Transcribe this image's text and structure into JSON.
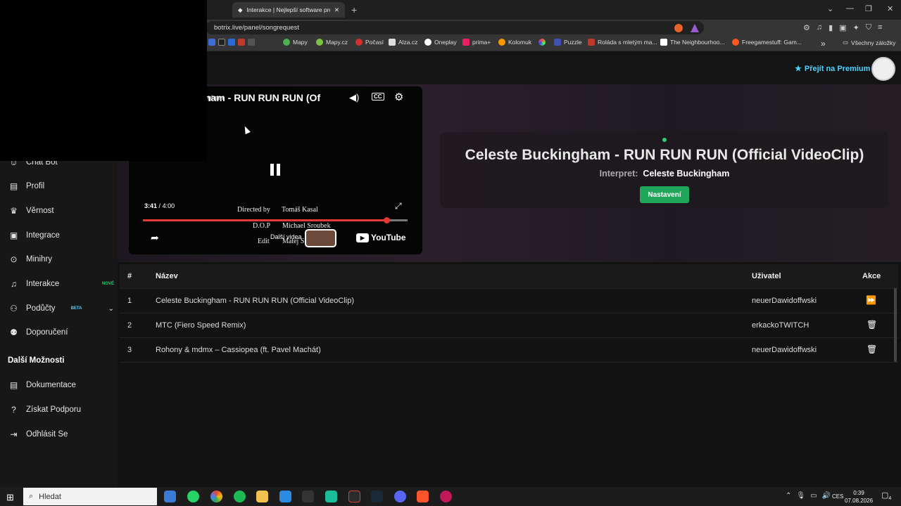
{
  "browser": {
    "tab_title": "Interakce | Nejlepší software pro",
    "url": "botrix.live/panel/songrequest"
  },
  "bookmarks": [
    "Mapy",
    "Mapy.cz",
    "Počasí",
    "Alza.cz",
    "Oneplay",
    "prima+",
    "Kolomuk",
    "Puzzle",
    "Roláda s mletým ma...",
    "The Neighbourhoo...",
    "Freegamestuff: Gam..."
  ],
  "bookmarks_more": "»",
  "all_bookmarks": "Všechny záložky",
  "header": {
    "premium": "Přejít na Premium"
  },
  "sidebar": {
    "items": [
      {
        "label": "Chat Bot",
        "icon": "robot-icon"
      },
      {
        "label": "Profil",
        "icon": "id-card-icon"
      },
      {
        "label": "Věrnost",
        "icon": "trophy-icon"
      },
      {
        "label": "Integrace",
        "icon": "plug-icon"
      },
      {
        "label": "Minihry",
        "icon": "gamepad-icon"
      },
      {
        "label": "Interakce",
        "icon": "music-icon",
        "badge": "NOVÉ",
        "badge_color": "#2ecc71"
      },
      {
        "label": "Podůčty",
        "icon": "users-icon",
        "badge": "BETA",
        "badge_color": "#4ad3ff"
      },
      {
        "label": "Doporučení",
        "icon": "people-icon"
      }
    ],
    "section": "Další Možnosti",
    "more_items": [
      {
        "label": "Dokumentace",
        "icon": "docs-icon"
      },
      {
        "label": "Získat Podporu",
        "icon": "help-icon"
      },
      {
        "label": "Odhlásit Se",
        "icon": "logout-icon"
      }
    ]
  },
  "player": {
    "title": "ham - RUN RUN RUN (Of",
    "channel": "gham",
    "time_current": "3:41",
    "time_sep": "/",
    "time_total": "4:00",
    "progress": 0.92,
    "credits": [
      "Directed by",
      "Tomáš Kasal",
      "D.O.P",
      "Michael Sroubek",
      "Edit",
      "Matej S"
    ],
    "more_videos": "Další videa",
    "youtube": "YouTube"
  },
  "now_playing": {
    "title": "Celeste Buckingham - RUN RUN RUN (Official VideoClip)",
    "interpret_label": "Interpret:",
    "interpret": "Celeste Buckingham",
    "settings_button": "Nastavení"
  },
  "table": {
    "headers": [
      "#",
      "Název",
      "Uživatel",
      "Akce"
    ],
    "rows": [
      {
        "n": "1",
        "title": "Celeste Buckingham - RUN RUN RUN (Official VideoClip)",
        "user": "neuerDawidoffwski",
        "action": "skip-icon"
      },
      {
        "n": "2",
        "title": "MTC (Fiero Speed Remix)",
        "user": "erkackoTWITCH",
        "action": "trash-icon"
      },
      {
        "n": "3",
        "title": "Rohony & mdmx – Cassiopea (ft. Pavel Machát)",
        "user": "neuerDawidoffwski",
        "action": "trash-icon"
      }
    ]
  },
  "taskbar": {
    "search": "Hledat",
    "lang": "CES",
    "time": "0:39",
    "date": "07.08.2026",
    "notifications": "4"
  }
}
